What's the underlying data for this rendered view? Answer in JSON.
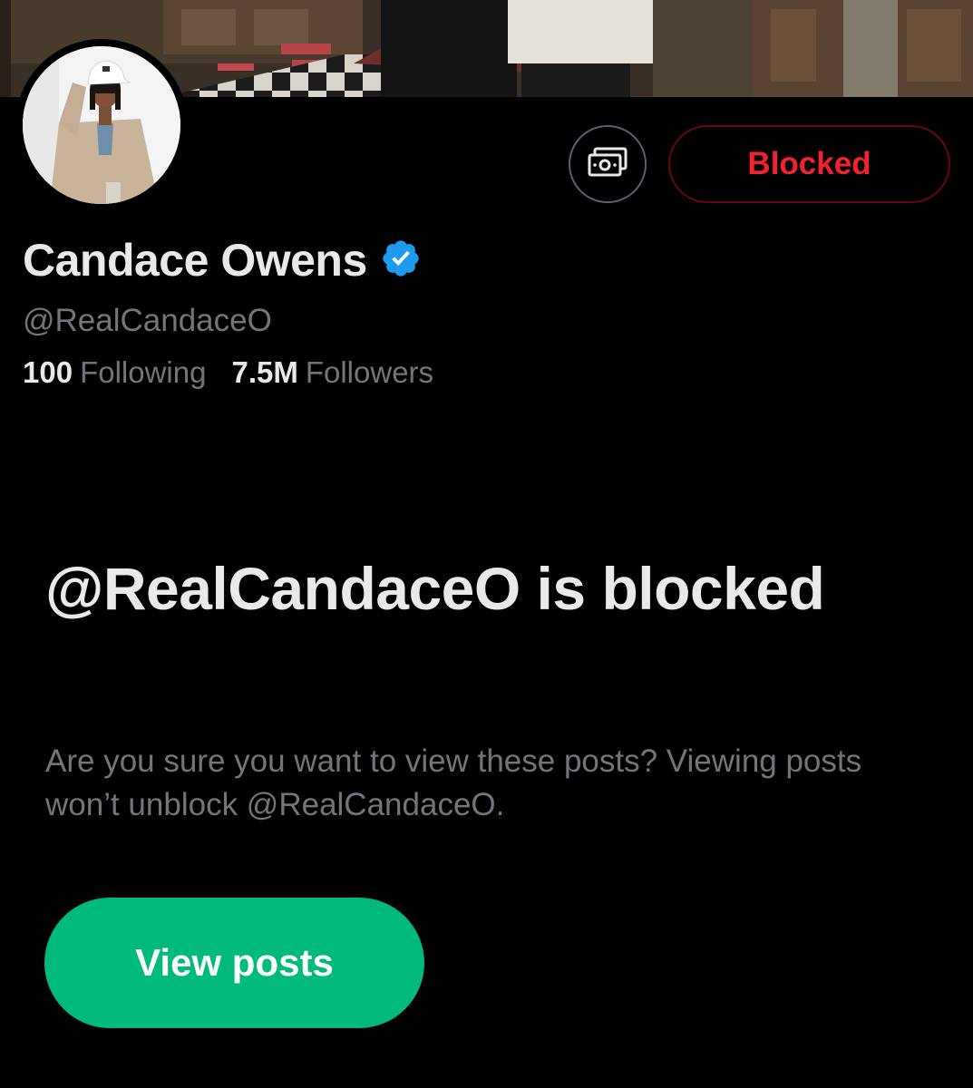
{
  "profile": {
    "display_name": "Candace Owens",
    "handle": "@RealCandaceO",
    "verified": true,
    "following_count": "100",
    "following_label": "Following",
    "followers_count": "7.5M",
    "followers_label": "Followers"
  },
  "actions": {
    "subscribe_icon": "money-icon",
    "blocked_label": "Blocked"
  },
  "notice": {
    "title": "@RealCandaceO is blocked",
    "description": "Are you sure you want to view these posts? Viewing posts won’t unblock @RealCandaceO.",
    "view_posts_label": "View posts"
  },
  "colors": {
    "background": "#000000",
    "primary_text": "#e7e9ea",
    "secondary_text": "#71767b",
    "blocked_red": "#f4212e",
    "blocked_border": "#67070f",
    "verified_blue": "#1d9bf0",
    "view_posts_green": "#00ba7c"
  }
}
